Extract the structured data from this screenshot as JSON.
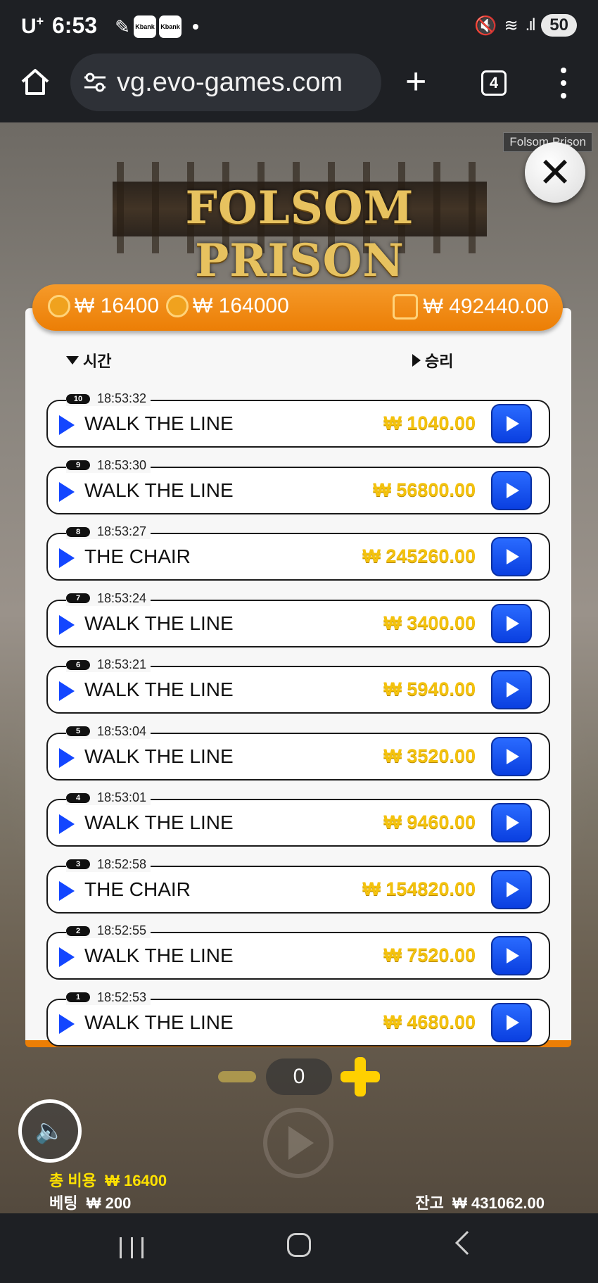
{
  "status": {
    "carrier": "U",
    "carrier_sup": "+",
    "time": "6:53",
    "apps": [
      "Kbank",
      "Kbank"
    ],
    "battery": "50"
  },
  "browser": {
    "url": "vg.evo-games.com",
    "tab_count": "4"
  },
  "game": {
    "tooltip": "Folsom Prison",
    "logo": "FOLSOM PRISON",
    "close_icon": "close-icon"
  },
  "header": {
    "cost1": "₩ 16400",
    "cost2": "₩ 164000",
    "total_win": "₩ 492440.00"
  },
  "columns": {
    "time": "시간",
    "win": "승리"
  },
  "rows": [
    {
      "num": "10",
      "time": "18:53:32",
      "name": "WALK THE LINE",
      "amount": "₩ 1040.00"
    },
    {
      "num": "9",
      "time": "18:53:30",
      "name": "WALK THE LINE",
      "amount": "₩ 56800.00"
    },
    {
      "num": "8",
      "time": "18:53:27",
      "name": "THE CHAIR",
      "amount": "₩ 245260.00"
    },
    {
      "num": "7",
      "time": "18:53:24",
      "name": "WALK THE LINE",
      "amount": "₩ 3400.00"
    },
    {
      "num": "6",
      "time": "18:53:21",
      "name": "WALK THE LINE",
      "amount": "₩ 5940.00"
    },
    {
      "num": "5",
      "time": "18:53:04",
      "name": "WALK THE LINE",
      "amount": "₩ 3520.00"
    },
    {
      "num": "4",
      "time": "18:53:01",
      "name": "WALK THE LINE",
      "amount": "₩ 9460.00"
    },
    {
      "num": "3",
      "time": "18:52:58",
      "name": "THE CHAIR",
      "amount": "₩ 154820.00"
    },
    {
      "num": "2",
      "time": "18:52:55",
      "name": "WALK THE LINE",
      "amount": "₩ 7520.00"
    },
    {
      "num": "1",
      "time": "18:52:53",
      "name": "WALK THE LINE",
      "amount": "₩ 4680.00"
    }
  ],
  "controls": {
    "counter": "0",
    "total_cost_label": "총 비용",
    "total_cost_value": "₩ 16400",
    "bet_label": "베팅",
    "bet_value": "₩ 200",
    "balance_label": "잔고",
    "balance_value": "₩ 431062.00"
  },
  "colors": {
    "accent_orange": "#ec7e05",
    "play_blue": "#1346ff",
    "amount_gold": "#f4c20d"
  }
}
